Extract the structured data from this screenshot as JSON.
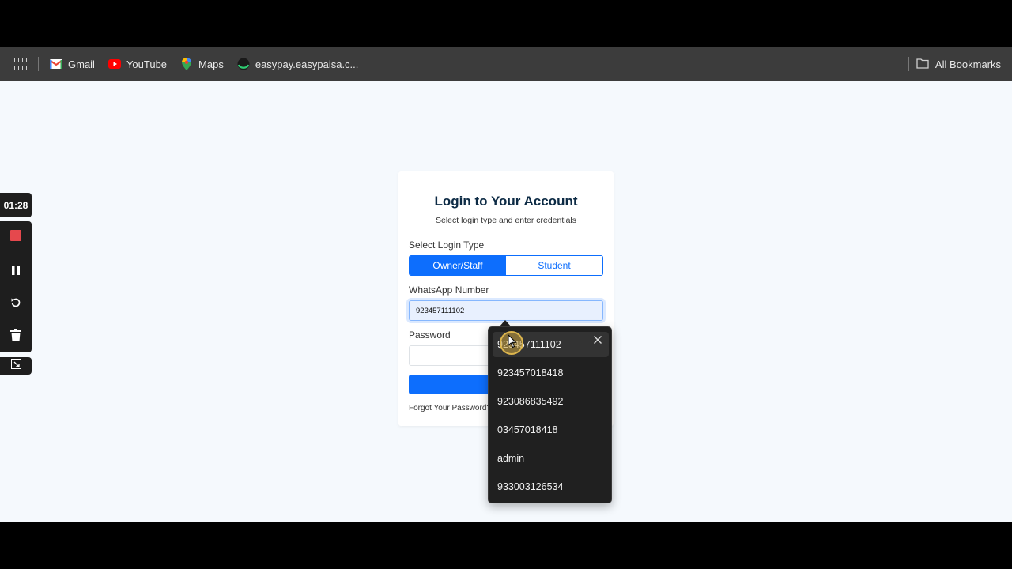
{
  "bookmarks": {
    "items": [
      {
        "label": "Gmail",
        "icon": "gmail-icon"
      },
      {
        "label": "YouTube",
        "icon": "youtube-icon"
      },
      {
        "label": "Maps",
        "icon": "maps-icon"
      },
      {
        "label": "easypay.easypaisa.c...",
        "icon": "easypaisa-icon"
      }
    ],
    "all_bookmarks": "All Bookmarks"
  },
  "recorder": {
    "time": "01:28"
  },
  "login": {
    "title": "Login to Your Account",
    "subtitle": "Select login type and enter credentials",
    "login_type_label": "Select Login Type",
    "types": [
      "Owner/Staff",
      "Student"
    ],
    "selected_type": "Owner/Staff",
    "whatsapp_label": "WhatsApp Number",
    "whatsapp_value": "923457111102",
    "password_label": "Password",
    "forgot": "Forgot Your Password?"
  },
  "autocomplete": {
    "options": [
      "923457111102",
      "923457018418",
      "923086835492",
      "03457018418",
      "admin",
      "933003126534"
    ]
  },
  "colors": {
    "primary": "#0d6efd",
    "page_bg": "#f5f9fd",
    "dropdown_bg": "#202020",
    "record_red": "#e5484d"
  }
}
